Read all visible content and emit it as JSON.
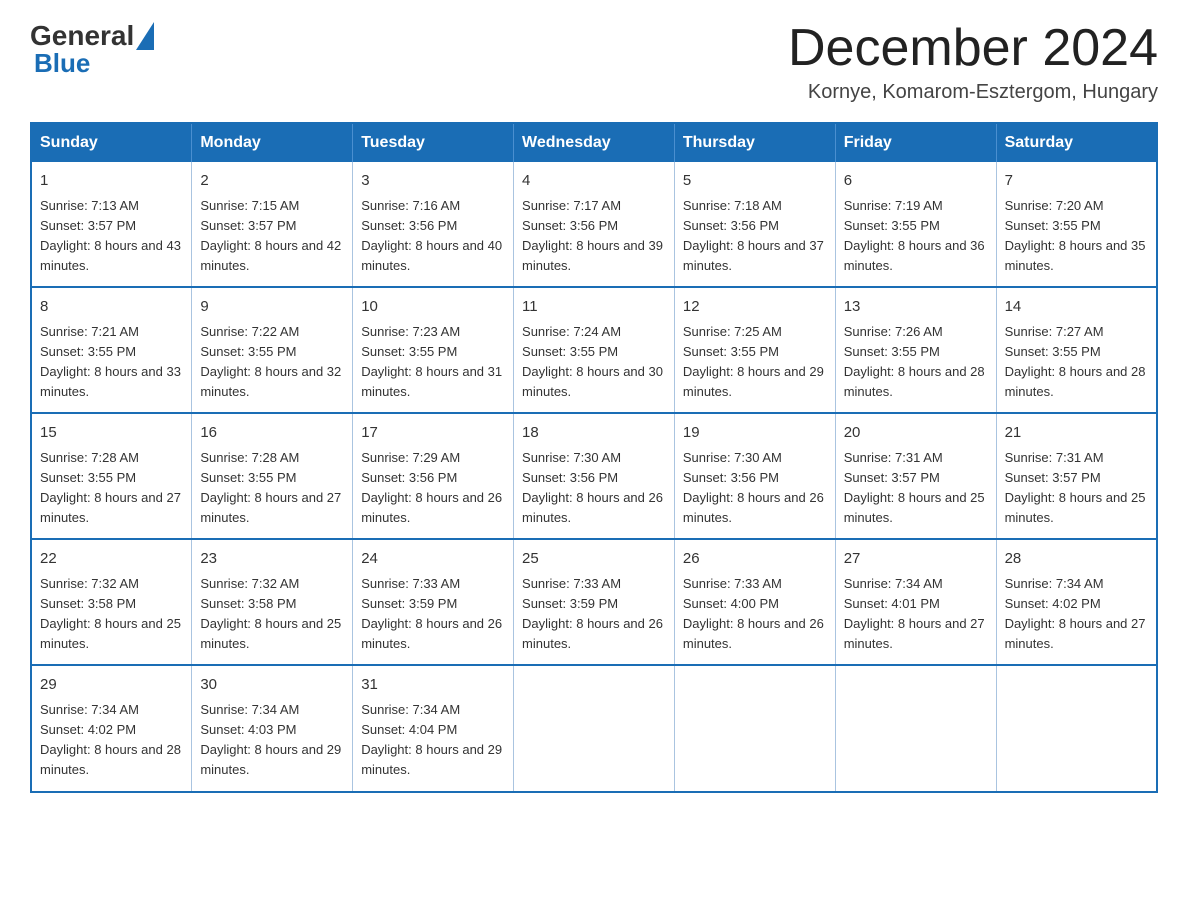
{
  "header": {
    "logo_line1": "General",
    "logo_line2": "Blue",
    "month_title": "December 2024",
    "location": "Kornye, Komarom-Esztergom, Hungary"
  },
  "weekdays": [
    "Sunday",
    "Monday",
    "Tuesday",
    "Wednesday",
    "Thursday",
    "Friday",
    "Saturday"
  ],
  "weeks": [
    [
      {
        "day": "1",
        "sunrise": "7:13 AM",
        "sunset": "3:57 PM",
        "daylight": "8 hours and 43 minutes."
      },
      {
        "day": "2",
        "sunrise": "7:15 AM",
        "sunset": "3:57 PM",
        "daylight": "8 hours and 42 minutes."
      },
      {
        "day": "3",
        "sunrise": "7:16 AM",
        "sunset": "3:56 PM",
        "daylight": "8 hours and 40 minutes."
      },
      {
        "day": "4",
        "sunrise": "7:17 AM",
        "sunset": "3:56 PM",
        "daylight": "8 hours and 39 minutes."
      },
      {
        "day": "5",
        "sunrise": "7:18 AM",
        "sunset": "3:56 PM",
        "daylight": "8 hours and 37 minutes."
      },
      {
        "day": "6",
        "sunrise": "7:19 AM",
        "sunset": "3:55 PM",
        "daylight": "8 hours and 36 minutes."
      },
      {
        "day": "7",
        "sunrise": "7:20 AM",
        "sunset": "3:55 PM",
        "daylight": "8 hours and 35 minutes."
      }
    ],
    [
      {
        "day": "8",
        "sunrise": "7:21 AM",
        "sunset": "3:55 PM",
        "daylight": "8 hours and 33 minutes."
      },
      {
        "day": "9",
        "sunrise": "7:22 AM",
        "sunset": "3:55 PM",
        "daylight": "8 hours and 32 minutes."
      },
      {
        "day": "10",
        "sunrise": "7:23 AM",
        "sunset": "3:55 PM",
        "daylight": "8 hours and 31 minutes."
      },
      {
        "day": "11",
        "sunrise": "7:24 AM",
        "sunset": "3:55 PM",
        "daylight": "8 hours and 30 minutes."
      },
      {
        "day": "12",
        "sunrise": "7:25 AM",
        "sunset": "3:55 PM",
        "daylight": "8 hours and 29 minutes."
      },
      {
        "day": "13",
        "sunrise": "7:26 AM",
        "sunset": "3:55 PM",
        "daylight": "8 hours and 28 minutes."
      },
      {
        "day": "14",
        "sunrise": "7:27 AM",
        "sunset": "3:55 PM",
        "daylight": "8 hours and 28 minutes."
      }
    ],
    [
      {
        "day": "15",
        "sunrise": "7:28 AM",
        "sunset": "3:55 PM",
        "daylight": "8 hours and 27 minutes."
      },
      {
        "day": "16",
        "sunrise": "7:28 AM",
        "sunset": "3:55 PM",
        "daylight": "8 hours and 27 minutes."
      },
      {
        "day": "17",
        "sunrise": "7:29 AM",
        "sunset": "3:56 PM",
        "daylight": "8 hours and 26 minutes."
      },
      {
        "day": "18",
        "sunrise": "7:30 AM",
        "sunset": "3:56 PM",
        "daylight": "8 hours and 26 minutes."
      },
      {
        "day": "19",
        "sunrise": "7:30 AM",
        "sunset": "3:56 PM",
        "daylight": "8 hours and 26 minutes."
      },
      {
        "day": "20",
        "sunrise": "7:31 AM",
        "sunset": "3:57 PM",
        "daylight": "8 hours and 25 minutes."
      },
      {
        "day": "21",
        "sunrise": "7:31 AM",
        "sunset": "3:57 PM",
        "daylight": "8 hours and 25 minutes."
      }
    ],
    [
      {
        "day": "22",
        "sunrise": "7:32 AM",
        "sunset": "3:58 PM",
        "daylight": "8 hours and 25 minutes."
      },
      {
        "day": "23",
        "sunrise": "7:32 AM",
        "sunset": "3:58 PM",
        "daylight": "8 hours and 25 minutes."
      },
      {
        "day": "24",
        "sunrise": "7:33 AM",
        "sunset": "3:59 PM",
        "daylight": "8 hours and 26 minutes."
      },
      {
        "day": "25",
        "sunrise": "7:33 AM",
        "sunset": "3:59 PM",
        "daylight": "8 hours and 26 minutes."
      },
      {
        "day": "26",
        "sunrise": "7:33 AM",
        "sunset": "4:00 PM",
        "daylight": "8 hours and 26 minutes."
      },
      {
        "day": "27",
        "sunrise": "7:34 AM",
        "sunset": "4:01 PM",
        "daylight": "8 hours and 27 minutes."
      },
      {
        "day": "28",
        "sunrise": "7:34 AM",
        "sunset": "4:02 PM",
        "daylight": "8 hours and 27 minutes."
      }
    ],
    [
      {
        "day": "29",
        "sunrise": "7:34 AM",
        "sunset": "4:02 PM",
        "daylight": "8 hours and 28 minutes."
      },
      {
        "day": "30",
        "sunrise": "7:34 AM",
        "sunset": "4:03 PM",
        "daylight": "8 hours and 29 minutes."
      },
      {
        "day": "31",
        "sunrise": "7:34 AM",
        "sunset": "4:04 PM",
        "daylight": "8 hours and 29 minutes."
      },
      null,
      null,
      null,
      null
    ]
  ]
}
